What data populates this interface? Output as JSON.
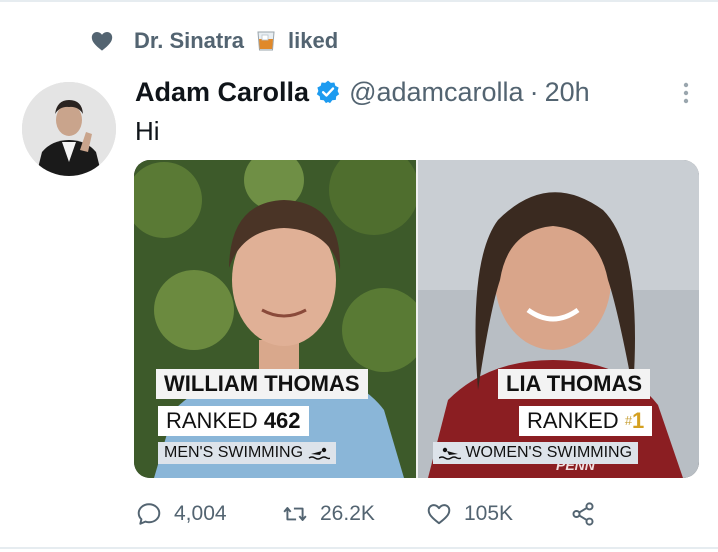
{
  "social_context": {
    "user": "Dr. Sinatra",
    "action": "liked",
    "emoji_icon": "whiskey-glass-icon"
  },
  "tweet": {
    "display_name": "Adam Carolla",
    "handle": "@adamcarolla",
    "separator": "·",
    "time": "20h",
    "text": "Hi",
    "verified_color": "#1d9bf0"
  },
  "media": {
    "left": {
      "name": "WILLIAM THOMAS",
      "rank_label": "RANKED",
      "rank_value": "462",
      "sport": "MEN'S SWIMMING"
    },
    "right": {
      "name": "LIA THOMAS",
      "rank_label": "RANKED",
      "rank_hash": "#",
      "rank_value": "1",
      "sport": "WOMEN'S SWIMMING",
      "jersey_text": "PENN"
    }
  },
  "actions": {
    "replies": "4,004",
    "retweets": "26.2K",
    "likes": "105K"
  },
  "colors": {
    "secondary_text": "#536471",
    "divider": "#e6ecf0",
    "primary_text": "#0f1419"
  }
}
